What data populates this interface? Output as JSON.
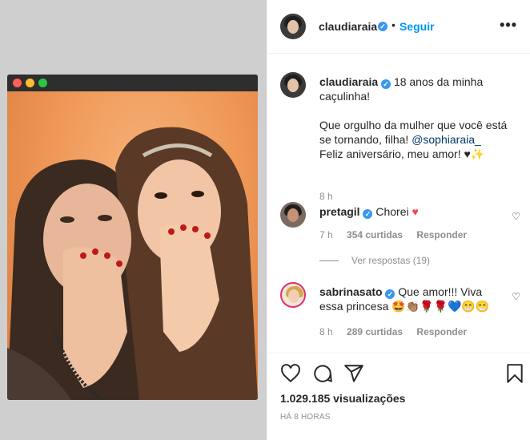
{
  "post": {
    "author": "claudiaraia",
    "follow_label": "Seguir",
    "separator": "•",
    "more_label": "•••"
  },
  "caption": {
    "user": "claudiaraia",
    "line1": "18 anos da minha",
    "line2": "caçulinha!",
    "line3": "Que orgulho da mulher que você está",
    "line4_pre": "se tornando, filha!",
    "mention": "@sophiaraia_",
    "line5": "Feliz aniversário, meu amor! ♥✨",
    "time": "8 h"
  },
  "comments": [
    {
      "user": "pretagil",
      "text": "Chorei",
      "emoji": "♥",
      "time": "7 h",
      "likes": "354 curtidas",
      "reply": "Responder"
    },
    {
      "user": "sabrinasato",
      "text1": "Que amor!!! Viva",
      "text2": "essa princesa 🤩👏🏽🌹🌹💙😁😁",
      "time": "8 h",
      "likes": "289 curtidas",
      "reply": "Responder"
    }
  ],
  "view_replies": "Ver respostas (19)",
  "stats": {
    "views": "1.029.185 visualizações",
    "time": "HÁ 8 HORAS"
  },
  "icons": [
    "like-icon",
    "comment-icon",
    "share-icon",
    "save-icon",
    "more-icon"
  ],
  "colors": {
    "accent": "#0095f6",
    "verified": "#3897f0",
    "heart": "#ed4956"
  }
}
